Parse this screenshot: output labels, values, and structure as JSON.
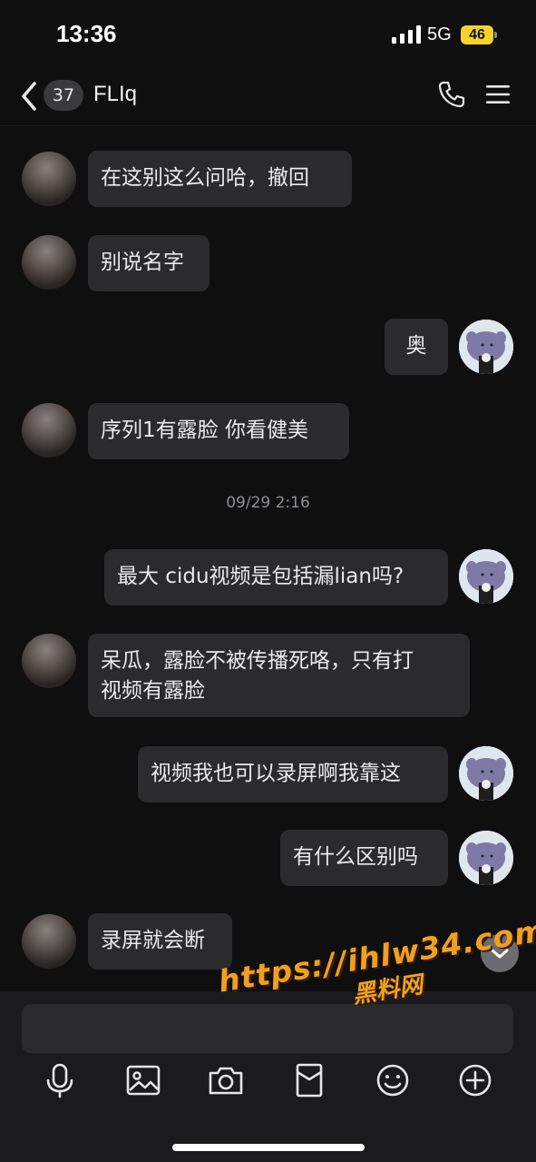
{
  "status_bar": {
    "time": "13:36",
    "network": "5G",
    "battery": "46"
  },
  "header": {
    "unread_count": "37",
    "title": "FLIq"
  },
  "messages": [
    {
      "side": "other",
      "text": "在这别这么问哈，撤回"
    },
    {
      "side": "other",
      "text": "别说名字"
    },
    {
      "side": "me",
      "text": "奥"
    },
    {
      "side": "other",
      "text": "序列1有露脸 你看健美"
    },
    {
      "side": "me",
      "text": "最大 cidu视频是包括漏lian吗?"
    },
    {
      "side": "other",
      "text": "呆瓜，露脸不被传播死咯，只有打\n视频有露脸"
    },
    {
      "side": "me",
      "text": "视频我也可以录屏啊我靠这"
    },
    {
      "side": "me",
      "text": "有什么区别吗"
    },
    {
      "side": "other",
      "text": "录屏就会断"
    }
  ],
  "timestamp": "09/29 2:16",
  "input": {
    "placeholder": ""
  },
  "toolbar": [
    "microphone-icon",
    "image-icon",
    "camera-icon",
    "red-packet-icon",
    "emoji-icon",
    "plus-icon"
  ],
  "watermark": {
    "url": "https://ihlw34.com",
    "sub": "黑料网"
  },
  "colors": {
    "background": "#0f0f10",
    "bubble": "#2b2b2e",
    "battery": "#f5d32a",
    "watermark": "#f0a020"
  }
}
